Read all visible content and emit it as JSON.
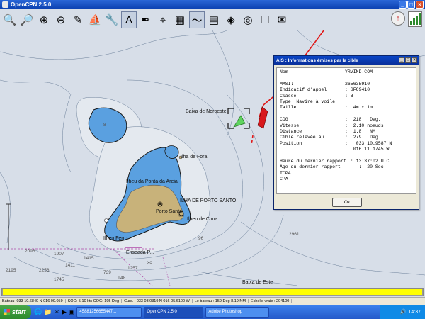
{
  "window": {
    "title": "OpenCPN 2.5.0"
  },
  "toolbar": {
    "buttons": [
      {
        "name": "zoom-in",
        "icon": "🔍"
      },
      {
        "name": "zoom-out",
        "icon": "🔎"
      },
      {
        "name": "scale-in",
        "icon": "⊕"
      },
      {
        "name": "scale-out",
        "icon": "⊖"
      },
      {
        "name": "route",
        "icon": "✎"
      },
      {
        "name": "auto-follow",
        "icon": "⛵"
      },
      {
        "name": "settings",
        "icon": "🔧"
      },
      {
        "name": "text",
        "icon": "A"
      },
      {
        "name": "tide",
        "icon": "✒"
      },
      {
        "name": "current",
        "icon": "⌖"
      },
      {
        "name": "ais",
        "icon": "▦"
      },
      {
        "name": "chart-quilting",
        "icon": "〜"
      },
      {
        "name": "print",
        "icon": "▤"
      },
      {
        "name": "route-manager",
        "icon": "◈"
      },
      {
        "name": "mob",
        "icon": "◎"
      },
      {
        "name": "layers",
        "icon": "☐"
      },
      {
        "name": "help",
        "icon": "✉"
      }
    ]
  },
  "chart": {
    "labels": {
      "baixa_noroeste": "Baixa de Noroeste",
      "ilha_fora": "Ilha de Fora",
      "ilheu_ponta": "Ilheu da Ponta da Areia",
      "ilha_porto_santo": "ILHA DE PORTO SANTO",
      "porto_santo": "Porto Santo",
      "ilheu_cima": "Ilheu de Cima",
      "ilheu_ferro": "Ilheu Ferro",
      "baixa_este": "Baixa de Este",
      "enseada": "Enseada P..."
    },
    "depths": {
      "d8": "8",
      "d96": "96",
      "d2961": "2961",
      "d2096": "2096",
      "d1907": "1907",
      "d1411": "1411",
      "d2256": "2256",
      "d2195": "2195",
      "d1745": "1745",
      "d1415": "1415",
      "d739": "739",
      "d748": "T48",
      "d1257": "1257",
      "dxo": "xo"
    }
  },
  "ais_dialog": {
    "title": "AIS : Informations émises par la cible",
    "rows": [
      {
        "k": "Nom  :",
        "v": "YRVIND.COM"
      },
      {
        "gap": true
      },
      {
        "k": "MMSI:",
        "v": "265635910"
      },
      {
        "k": "Indicatif d'appel",
        "v": ": SFC9410"
      },
      {
        "k": "Classe",
        "v": ": B"
      },
      {
        "k": "Type :Navire à voile",
        "v": ""
      },
      {
        "k": "Taille",
        "v": ":  4m x 1m"
      },
      {
        "gap": true
      },
      {
        "k": "COG",
        "v": ":  218   Deg."
      },
      {
        "k": "Vitesse",
        "v": ":  2.10 noeuds."
      },
      {
        "k": "Distance",
        "v": ":  1.8   NM"
      },
      {
        "k": "Cible relevée au",
        "v": ":  279   Deg."
      },
      {
        "k": "Position",
        "v": ":   033 10.9587 N"
      },
      {
        "k": "",
        "v": "   016 11.1745 W"
      },
      {
        "gap": true
      },
      {
        "k": "Heure du dernier rapport",
        "v": "  : 13:37:02 UTC"
      },
      {
        "k": "Age du dernier rapport",
        "v": "     :  20 Sec."
      },
      {
        "k": "TCPA :",
        "v": ""
      },
      {
        "k": "CPA  :",
        "v": ""
      }
    ],
    "ok_label": "Ok"
  },
  "progress": {
    "value": 1.0
  },
  "statusbar": {
    "bateau": "Bateau :033 10.6849 N  016 09.059",
    "sog": "SOG: 5.10 kts  COG:   195 Deg",
    "curs": "Curs. : 033 03.0319 N 016 05.6100 W",
    "le_bateau": "Le bateau : 159 Deg      8.19 NM",
    "echelle": "Echelle vraie :   204100"
  },
  "taskbar": {
    "start_label": "start",
    "tasks": [
      {
        "label": "45881256655447..."
      },
      {
        "label": "OpenCPN 2.5.0",
        "active": true
      },
      {
        "label": "Adobe Photoshop"
      }
    ],
    "clock": "14:37"
  }
}
